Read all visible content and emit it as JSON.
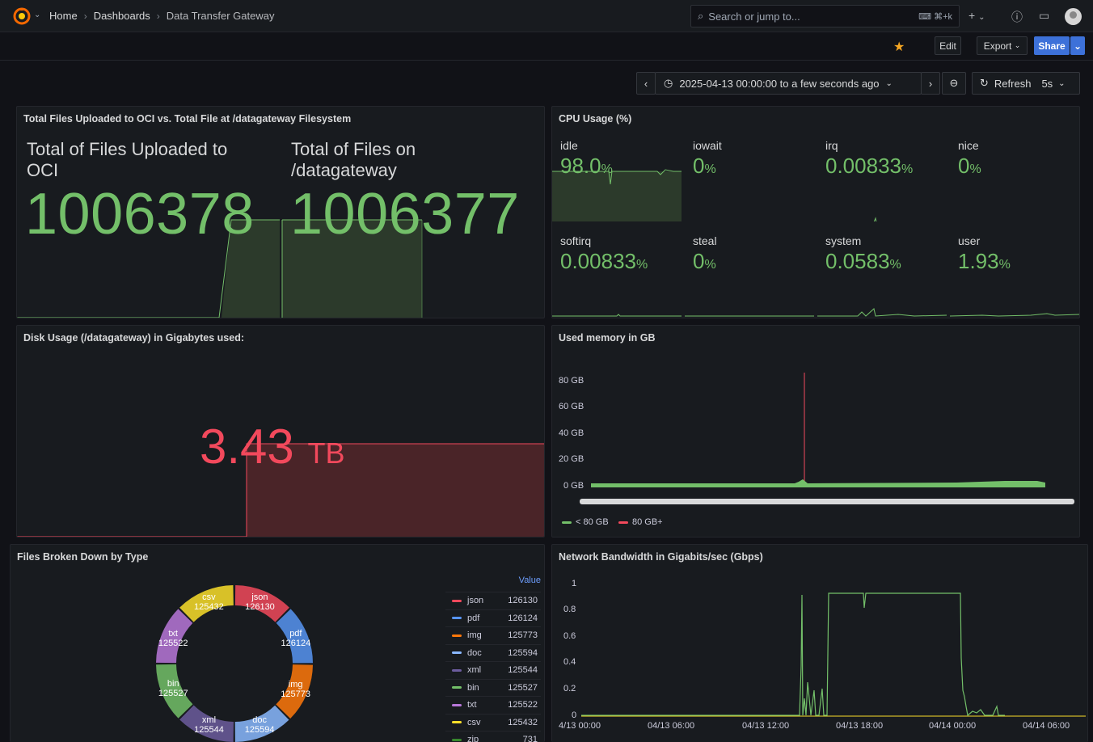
{
  "topbar": {
    "crumbs": [
      "Home",
      "Dashboards",
      "Data Transfer Gateway"
    ],
    "search_placeholder": "Search or jump to...",
    "search_shortcut": "⌘+k",
    "new_label": "+",
    "help_icon": "help-icon",
    "news_icon": "news-icon"
  },
  "toolbar": {
    "edit_label": "Edit",
    "export_label": "Export",
    "share_label": "Share"
  },
  "timepicker": {
    "range_label": "2025-04-13 00:00:00 to a few seconds ago",
    "refresh_label": "Refresh",
    "interval_label": "5s"
  },
  "colors": {
    "green": "#73bf69",
    "red": "#f2495c",
    "accent_blue": "#3d71d9",
    "panel_bg": "#181b1f",
    "page_bg": "#111217"
  },
  "panels": {
    "files": {
      "title": "Total Files Uploaded to OCI vs. Total File at /datagateway Filesystem",
      "uploaded_label_1": "Total of Files Uploaded to",
      "uploaded_label_2": "OCI",
      "uploaded_value": "1006378",
      "fs_label_1": "Total of Files on",
      "fs_label_2": "/datagateway",
      "fs_value": "1006377"
    },
    "cpu": {
      "title": "CPU Usage (%)",
      "cells": [
        {
          "label": "idle",
          "value": "98.0",
          "unit": "%"
        },
        {
          "label": "iowait",
          "value": "0",
          "unit": "%"
        },
        {
          "label": "irq",
          "value": "0.00833",
          "unit": "%"
        },
        {
          "label": "nice",
          "value": "0",
          "unit": "%"
        },
        {
          "label": "softirq",
          "value": "0.00833",
          "unit": "%"
        },
        {
          "label": "steal",
          "value": "0",
          "unit": "%"
        },
        {
          "label": "system",
          "value": "0.0583",
          "unit": "%"
        },
        {
          "label": "user",
          "value": "1.93",
          "unit": "%"
        }
      ]
    },
    "disk": {
      "title": "Disk Usage (/datagateway) in Gigabytes used:",
      "value": "3.43",
      "unit": "TB"
    },
    "memory": {
      "title": "Used memory in GB",
      "y_ticks": [
        "80 GB",
        "60 GB",
        "40 GB",
        "20 GB",
        "0 GB"
      ],
      "legend": [
        {
          "name": "< 80 GB",
          "color": "#73bf69"
        },
        {
          "name": "80 GB+",
          "color": "#f2495c"
        }
      ]
    },
    "types": {
      "title": "Files Broken Down by Type",
      "value_header": "Value",
      "slices": [
        {
          "name": "json",
          "value": "126130",
          "color": "#f2495c"
        },
        {
          "name": "pdf",
          "value": "126124",
          "color": "#5794f2"
        },
        {
          "name": "img",
          "value": "125773",
          "color": "#ff780a"
        },
        {
          "name": "doc",
          "value": "125594",
          "color": "#8ab8ff"
        },
        {
          "name": "xml",
          "value": "125544",
          "color": "#6c5c9e"
        },
        {
          "name": "bin",
          "value": "125527",
          "color": "#73bf69"
        },
        {
          "name": "txt",
          "value": "125522",
          "color": "#b877d9"
        },
        {
          "name": "csv",
          "value": "125432",
          "color": "#fade2a"
        },
        {
          "name": "zip",
          "value": "731",
          "color": "#37872d"
        }
      ]
    },
    "network": {
      "title": "Network Bandwidth in Gigabits/sec (Gbps)",
      "y_ticks": [
        "1",
        "0.8",
        "0.6",
        "0.4",
        "0.2",
        "0"
      ],
      "x_ticks": [
        "4/13 00:00",
        "04/13 06:00",
        "04/13 12:00",
        "04/13 18:00",
        "04/14 00:00",
        "04/14 06:00"
      ]
    }
  },
  "chart_data": [
    {
      "type": "pie",
      "title": "Files Broken Down by Type",
      "categories": [
        "json",
        "pdf",
        "img",
        "doc",
        "xml",
        "bin",
        "txt",
        "csv",
        "zip"
      ],
      "values": [
        126130,
        126124,
        125773,
        125594,
        125544,
        125527,
        125522,
        125432,
        731
      ]
    },
    {
      "type": "line",
      "title": "Network Bandwidth in Gigabits/sec (Gbps)",
      "x": [
        "04/13 00:00",
        "04/13 06:00",
        "04/13 12:00",
        "04/13 18:00",
        "04/14 00:00",
        "04/14 06:00"
      ],
      "series": [
        {
          "values": [
            0,
            0,
            0,
            0.93,
            0,
            0
          ]
        }
      ],
      "ylim": [
        0,
        1
      ]
    },
    {
      "type": "line",
      "title": "Used memory in GB",
      "ylim": [
        0,
        80
      ],
      "series": [
        {
          "name": "< 80 GB",
          "values": [
            2,
            3,
            3,
            3,
            3
          ]
        },
        {
          "name": "80 GB+",
          "values": [
            0,
            0,
            85,
            0,
            0
          ]
        }
      ]
    }
  ]
}
